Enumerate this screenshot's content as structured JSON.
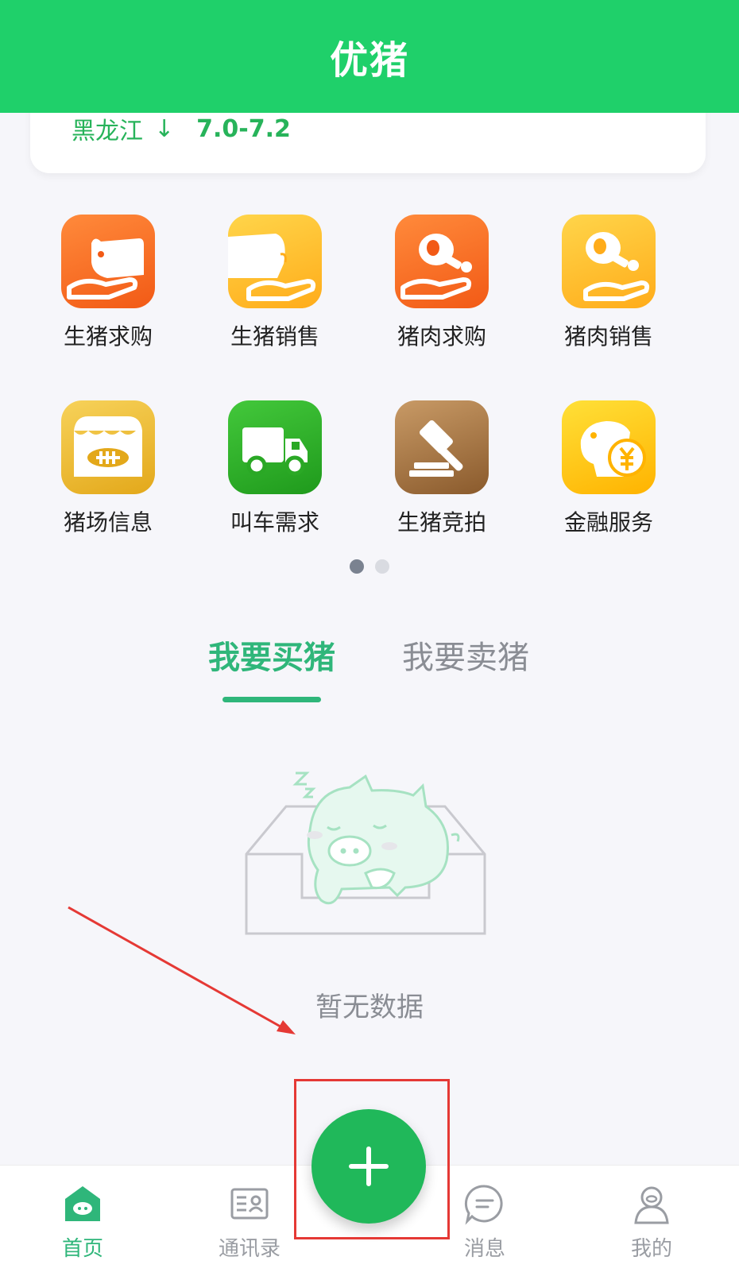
{
  "header": {
    "title": "优猪"
  },
  "price_card": {
    "region": "黑龙江",
    "trend_symbol": "↓",
    "price_range": "7.0-7.2"
  },
  "grid": {
    "items": [
      {
        "label": "生猪求购",
        "icon": "pig-buy-icon"
      },
      {
        "label": "生猪销售",
        "icon": "pig-sell-icon"
      },
      {
        "label": "猪肉求购",
        "icon": "pork-buy-icon"
      },
      {
        "label": "猪肉销售",
        "icon": "pork-sell-icon"
      },
      {
        "label": "猪场信息",
        "icon": "farm-store-icon"
      },
      {
        "label": "叫车需求",
        "icon": "truck-icon"
      },
      {
        "label": "生猪竞拍",
        "icon": "auction-gavel-icon"
      },
      {
        "label": "金融服务",
        "icon": "piggy-bank-yuan-icon"
      }
    ]
  },
  "pager": {
    "count": 2,
    "active_index": 0
  },
  "tabs": {
    "buy": "我要买猪",
    "sell": "我要卖猪",
    "active": "buy"
  },
  "empty_state": {
    "message": "暂无数据",
    "icon": "sleeping-pig-box-illustration"
  },
  "tabbar": {
    "home": "首页",
    "contacts": "通讯录",
    "messages": "消息",
    "me": "我的",
    "add_icon": "plus-icon"
  },
  "colors": {
    "header": "#1fd06a",
    "accent": "#2fb67a",
    "fab": "#20b85a",
    "annotation": "#e53935"
  }
}
